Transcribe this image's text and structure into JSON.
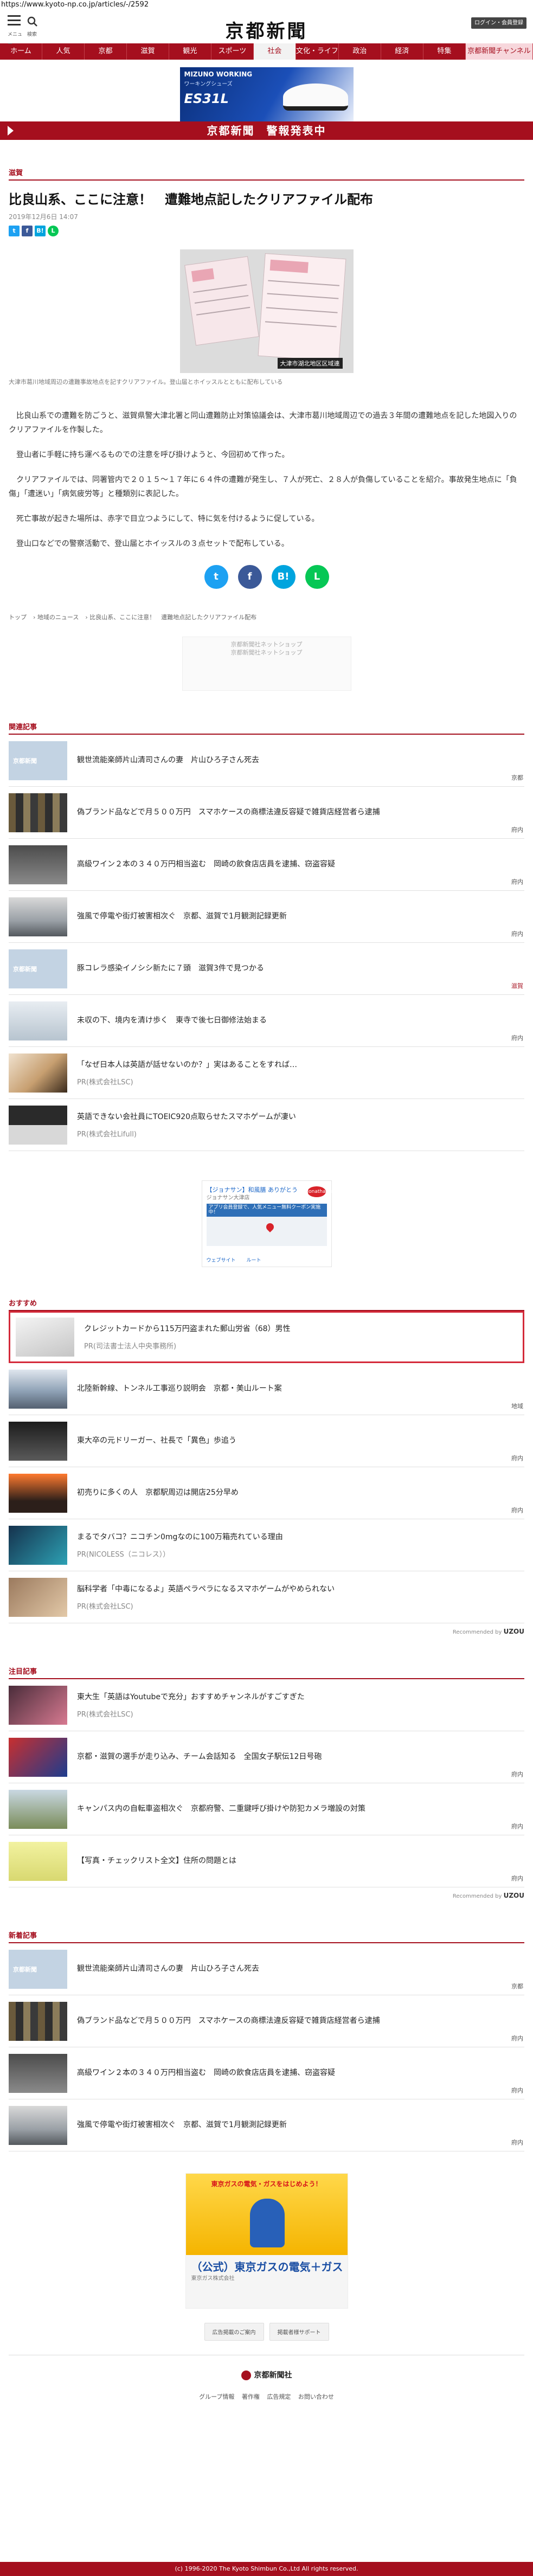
{
  "url": "https://www.kyoto-np.co.jp/articles/-/2592",
  "header": {
    "menu_label": "メニュー",
    "search_label": "検索",
    "logo": "京都新聞",
    "login_label": "ログイン・会員登録"
  },
  "nav": [
    "ホーム",
    "人気",
    "京都",
    "滋賀",
    "観光",
    "スポーツ",
    "社会",
    "文化・ライフ",
    "政治",
    "経済",
    "特集",
    "京都新聞チャンネル"
  ],
  "ad_banner": {
    "brand": "MIZUNO WORKING",
    "subtitle": "ワーキングシューズ",
    "model": "ES31L"
  },
  "breaking": "京都新聞　警報発表中",
  "article": {
    "category": "滋賀",
    "title": "比良山系、ここに注意！　遭難地点記したクリアファイル配布",
    "date": "2019年12月6日 14:07",
    "photo_label": "大津市湖北地区区域連",
    "caption": "大津市葛川地域周辺の遭難事故地点を記すクリアファイル。登山届とホイッスルとともに配布している",
    "paragraphs": [
      "比良山系での遭難を防ごうと、滋賀県警大津北署と同山遭難防止対策協議会は、大津市葛川地域周辺での過去３年間の遭難地点を記した地図入りのクリアファイルを作製した。",
      "登山者に手軽に持ち運べるものでの注意を呼び掛けようと、今回初めて作った。",
      "クリアファイルでは、同署管内で２０１５～１７年に６４件の遭難が発生し、７人が死亡、２８人が負傷していることを紹介。事故発生地点に「負傷」「遭迷い」「病気疲労等」と種類別に表記した。",
      "死亡事故が起きた場所は、赤字で目立つようにして、特に気を付けるように促している。",
      "登山口などでの警察活動で、登山届とホイッスルの３点セットで配布している。"
    ]
  },
  "breadcrumb": [
    "トップ",
    "地域のニュース",
    "比良山系、ここに注意！　遭難地点記したクリアファイル配布"
  ],
  "shop_ad": {
    "line1": "京都新聞社ネットショップ",
    "line2": "京都新聞社ネットショップ"
  },
  "related": {
    "heading": "関連記事",
    "items": [
      {
        "title": "観世流能楽師片山清司さんの妻　片山ひろ子さん死去",
        "tag": "京都"
      },
      {
        "title": "偽ブランド品などで月５００万円　スマホケースの商標法違反容疑で雑貨店経営者ら逮捕",
        "tag": "府内"
      },
      {
        "title": "高級ワイン２本の３４０万円相当盗む　岡崎の飲食店店員を逮捕、窃盗容疑",
        "tag": "府内"
      },
      {
        "title": "強風で停電や街灯被害相次ぐ　京都、滋賀で1月観測記録更新",
        "tag": "府内"
      },
      {
        "title": "豚コレラ感染イノシシ新たに７頭　滋賀3件で見つかる",
        "tag": "滋賀"
      },
      {
        "title": "未収の下、境内を清け歩く　東寺で後七日御修法始まる",
        "tag": "府内"
      },
      {
        "title": "「なぜ日本人は英語が話せないのか？」実はあることをすれば…",
        "sub": "PR(株式会社LSC)"
      },
      {
        "title": "英語できない会社員にTOEIC920点取らせたスマホゲームが凄い",
        "sub": "PR(株式会社Lifull)"
      }
    ]
  },
  "map_ad": {
    "title": "【ジョナサン】和風膳 ありがとう",
    "sub": "ジョナサン大津店",
    "logo": "Jonathan's",
    "blue": "アプリ会員登録で、人気メニュー無料クーポン実施中！",
    "link1": "ウェブサイト",
    "link2": "ルート"
  },
  "recommend": {
    "heading": "おすすめ",
    "items": [
      {
        "title": "クレジットカードから115万円盗まれた郵山労省（68）男性",
        "sub": "PR(司法書士法人中央事務所)"
      },
      {
        "title": "北陸新幹線、トンネル工事巡り説明会　京都・美山ルート案",
        "tag": "地域"
      },
      {
        "title": "東大卒の元ドリーガー、社長で「異色」歩追う",
        "tag": "府内"
      },
      {
        "title": "初売りに多くの人　京都駅周辺は開店25分早め",
        "tag": "府内"
      },
      {
        "title": "まるでタバコ？ニコチン0mgなのに100万箱売れている理由",
        "sub": "PR(NICOLESS（ニコレス））"
      },
      {
        "title": "脳科学者「中毒になるよ」英語ペラペラになるスマホゲームがやめられない",
        "sub": "PR(株式会社LSC)"
      }
    ],
    "recommended_by": "Recommended by",
    "brand": "UZOU"
  },
  "attention": {
    "heading": "注目記事",
    "items": [
      {
        "title": "東大生「英語はYoutubeで充分」おすすめチャンネルがすごすぎた",
        "sub": "PR(株式会社LSC)"
      },
      {
        "title": "京都・滋賀の選手が走り込み、チーム会話知る　全国女子駅伝12日号砲",
        "tag": "府内"
      },
      {
        "title": "キャンパス内の自転車盗相次ぐ　京都府警、二重鍵呼び掛けや防犯カメラ増設の対策",
        "tag": "府内"
      },
      {
        "title": "【写真・チェックリスト全文】住所の問題とは",
        "tag": "府内"
      }
    ],
    "recommended_by": "Recommended by",
    "brand": "UZOU"
  },
  "latest": {
    "heading": "新着記事",
    "items": [
      {
        "title": "観世流能楽師片山清司さんの妻　片山ひろ子さん死去",
        "tag": "京都"
      },
      {
        "title": "偽ブランド品などで月５００万円　スマホケースの商標法違反容疑で雑貨店経営者ら逮捕",
        "tag": "府内"
      },
      {
        "title": "高級ワイン２本の３４０万円相当盗む　岡崎の飲食店店員を逮捕、窃盗容疑",
        "tag": "府内"
      },
      {
        "title": "強風で停電や街灯被害相次ぐ　京都、滋賀で1月観測記録更新",
        "tag": "府内"
      }
    ]
  },
  "big_ad": {
    "head": "東京ガスの電気・ガスをはじめよう！",
    "main": "（公式）東京ガスの電気＋ガス",
    "sub": "東京ガス株式会社"
  },
  "ad_links": [
    "広告掲載のご案内",
    "掲載者様サポート"
  ],
  "footer": {
    "logo": "京都新聞社",
    "links": [
      "グループ情報",
      "著作権",
      "広告規定",
      "お問い合わせ"
    ],
    "copyright": "(c) 1996-2020 The Kyoto Shimbun Co.,Ltd All rights reserved."
  },
  "colors": {
    "brand": "#a50f1e",
    "accent_pink": "#f7d7dc"
  }
}
